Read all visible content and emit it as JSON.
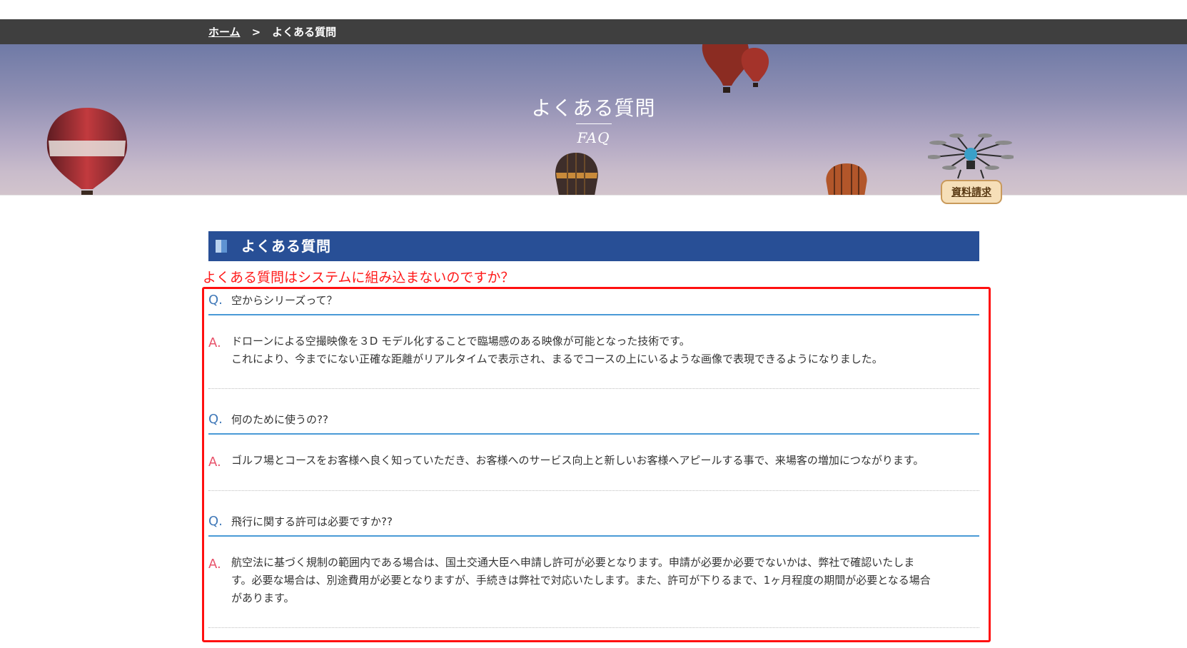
{
  "breadcrumb": {
    "home": "ホーム",
    "separator": ">",
    "current": "よくある質問"
  },
  "hero": {
    "title": "よくある質問",
    "subtitle": "FAQ"
  },
  "widget": {
    "doc_request_label": "資料請求"
  },
  "section": {
    "heading": "よくある質問"
  },
  "annotation": {
    "note": "よくある質問はシステムに組み込まないのですか？",
    "color": "#ff1010"
  },
  "faq": {
    "q_mark": "Q.",
    "a_mark": "A.",
    "items": [
      {
        "question": "空からシリーズって？",
        "answer_lines": [
          "ドローンによる空撮映像を３D モデル化することで臨場感のある映像が可能となった技術です。",
          "これにより、今までにない正確な距離がリアルタイムで表示され、まるでコースの上にいるような画像で表現できるようになりました。"
        ]
      },
      {
        "question": "何のために使うの??",
        "answer_lines": [
          "ゴルフ場とコースをお客様へ良く知っていただき、お客様へのサービス向上と新しいお客様へアピールする事で、来場客の増加につながります。"
        ]
      },
      {
        "question": "飛行に関する許可は必要ですか??",
        "answer_lines": [
          "航空法に基づく規制の範囲内である場合は、国土交通大臣へ申請し許可が必要となります。申請が必要か必要でないかは、弊社で確認いたしま",
          "す。必要な場合は、別途費用が必要となりますが、手続きは弊社で対応いたします。また、許可が下りるまで、1ヶ月程度の期間が必要となる場合",
          "があります。"
        ]
      }
    ]
  },
  "colors": {
    "breadcrumb_bar": "#3f3f3f",
    "heading_bar": "#284f96",
    "q_mark": "#3f78b8",
    "a_mark": "#e8526a",
    "q_rule": "#4a9ad6"
  }
}
